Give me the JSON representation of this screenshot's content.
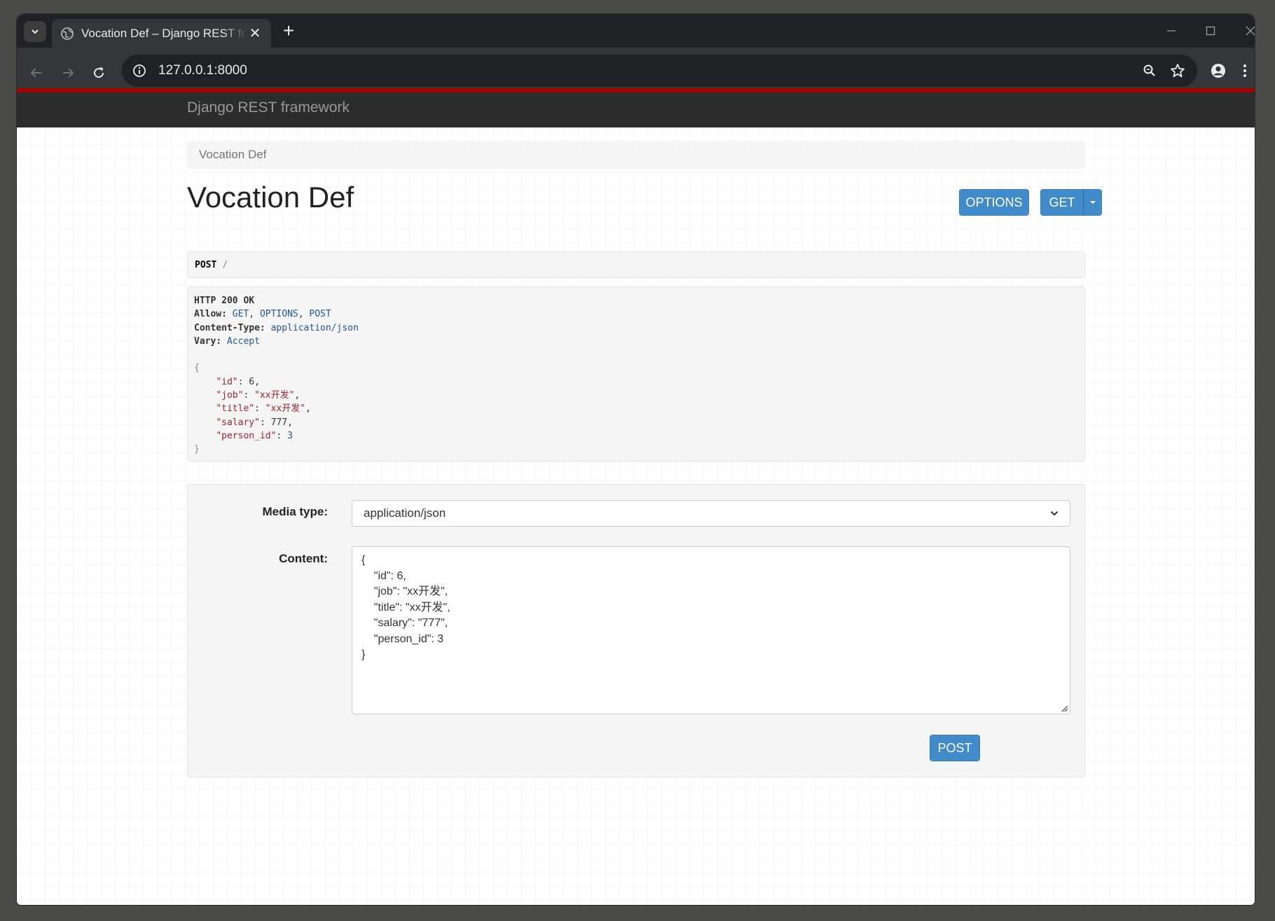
{
  "browser": {
    "tab_title": "Vocation Def – Django REST framework",
    "url": "127.0.0.1:8000",
    "new_tab_label": "+",
    "close_label": "✕"
  },
  "navbar": {
    "brand": "Django REST framework"
  },
  "breadcrumb": {
    "current": "Vocation Def"
  },
  "page": {
    "title": "Vocation Def",
    "options_label": "OPTIONS",
    "get_label": "GET"
  },
  "request": {
    "method": "POST",
    "path": "/"
  },
  "response": {
    "status": "HTTP 200 OK",
    "allow_key": "Allow:",
    "allow_methods": [
      "GET",
      "OPTIONS",
      "POST"
    ],
    "content_type_key": "Content-Type:",
    "content_type": "application/json",
    "vary_key": "Vary:",
    "vary": "Accept",
    "body": [
      {
        "key": "\"id\"",
        "value": "6",
        "kind": "number"
      },
      {
        "key": "\"job\"",
        "value": "\"xx开发\"",
        "kind": "string"
      },
      {
        "key": "\"title\"",
        "value": "\"xx开发\"",
        "kind": "string"
      },
      {
        "key": "\"salary\"",
        "value": "777",
        "kind": "number"
      },
      {
        "key": "\"person_id\"",
        "value": "3",
        "kind": "number"
      }
    ]
  },
  "form": {
    "media_type_label": "Media type:",
    "media_type_value": "application/json",
    "content_label": "Content:",
    "content_value": "{\n    \"id\": 6,\n    \"job\": \"xx开发\",\n    \"title\": \"xx开发\",\n    \"salary\": \"777\",\n    \"person_id\": 3\n}",
    "submit_label": "POST"
  },
  "colors": {
    "navbar_bg": "#2c2c2c",
    "navbar_accent": "#a30000",
    "button_primary": "#428bca"
  }
}
